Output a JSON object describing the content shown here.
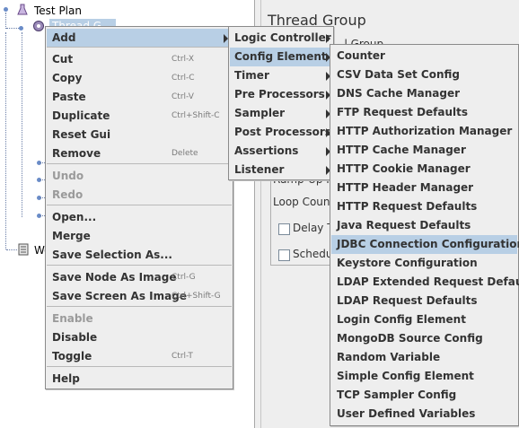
{
  "tree": {
    "root_label": "Test Plan",
    "child_label": "Thread G",
    "workbench_label": "Wo"
  },
  "right_pane": {
    "title": "Thread Group",
    "frag_top": "...l Group",
    "ramp_up_label": "Ramp-Up I",
    "loop_count_label": "Loop Count",
    "delay_label": "Delay Th",
    "scheduler_label": "Schedu"
  },
  "context_menu": {
    "items": [
      {
        "label": "Add",
        "shortcut": "",
        "submenu": true,
        "disabled": false,
        "highlighted": true
      },
      {
        "separator": true
      },
      {
        "label": "Cut",
        "shortcut": "Ctrl-X"
      },
      {
        "label": "Copy",
        "shortcut": "Ctrl-C"
      },
      {
        "label": "Paste",
        "shortcut": "Ctrl-V"
      },
      {
        "label": "Duplicate",
        "shortcut": "Ctrl+Shift-C"
      },
      {
        "label": "Reset Gui",
        "shortcut": ""
      },
      {
        "label": "Remove",
        "shortcut": "Delete"
      },
      {
        "separator": true
      },
      {
        "label": "Undo",
        "shortcut": "",
        "disabled": true
      },
      {
        "label": "Redo",
        "shortcut": "",
        "disabled": true
      },
      {
        "separator": true
      },
      {
        "label": "Open...",
        "shortcut": ""
      },
      {
        "label": "Merge",
        "shortcut": ""
      },
      {
        "label": "Save Selection As...",
        "shortcut": ""
      },
      {
        "separator": true
      },
      {
        "label": "Save Node As Image",
        "shortcut": "Ctrl-G"
      },
      {
        "label": "Save Screen As Image",
        "shortcut": "Ctrl+Shift-G"
      },
      {
        "separator": true
      },
      {
        "label": "Enable",
        "shortcut": "",
        "disabled": true
      },
      {
        "label": "Disable",
        "shortcut": ""
      },
      {
        "label": "Toggle",
        "shortcut": "Ctrl-T"
      },
      {
        "separator": true
      },
      {
        "label": "Help",
        "shortcut": ""
      }
    ]
  },
  "add_submenu": {
    "items": [
      {
        "label": "Logic Controller"
      },
      {
        "label": "Config Element",
        "highlighted": true
      },
      {
        "label": "Timer"
      },
      {
        "label": "Pre Processors"
      },
      {
        "label": "Sampler"
      },
      {
        "label": "Post Processors"
      },
      {
        "label": "Assertions"
      },
      {
        "label": "Listener"
      }
    ]
  },
  "config_submenu": {
    "items": [
      {
        "label": "Counter"
      },
      {
        "label": "CSV Data Set Config"
      },
      {
        "label": "DNS Cache Manager"
      },
      {
        "label": "FTP Request Defaults"
      },
      {
        "label": "HTTP Authorization Manager"
      },
      {
        "label": "HTTP Cache Manager"
      },
      {
        "label": "HTTP Cookie Manager"
      },
      {
        "label": "HTTP Header Manager"
      },
      {
        "label": "HTTP Request Defaults"
      },
      {
        "label": "Java Request Defaults"
      },
      {
        "label": "JDBC Connection Configuration",
        "highlighted": true
      },
      {
        "label": "Keystore Configuration"
      },
      {
        "label": "LDAP Extended Request Defaults"
      },
      {
        "label": "LDAP Request Defaults"
      },
      {
        "label": "Login Config Element"
      },
      {
        "label": "MongoDB Source Config"
      },
      {
        "label": "Random Variable"
      },
      {
        "label": "Simple Config Element"
      },
      {
        "label": "TCP Sampler Config"
      },
      {
        "label": "User Defined Variables"
      }
    ]
  },
  "colors": {
    "menu_bg": "#eeeeee",
    "highlight": "#b8cfe5",
    "disabled_text": "#9a9a9a"
  }
}
